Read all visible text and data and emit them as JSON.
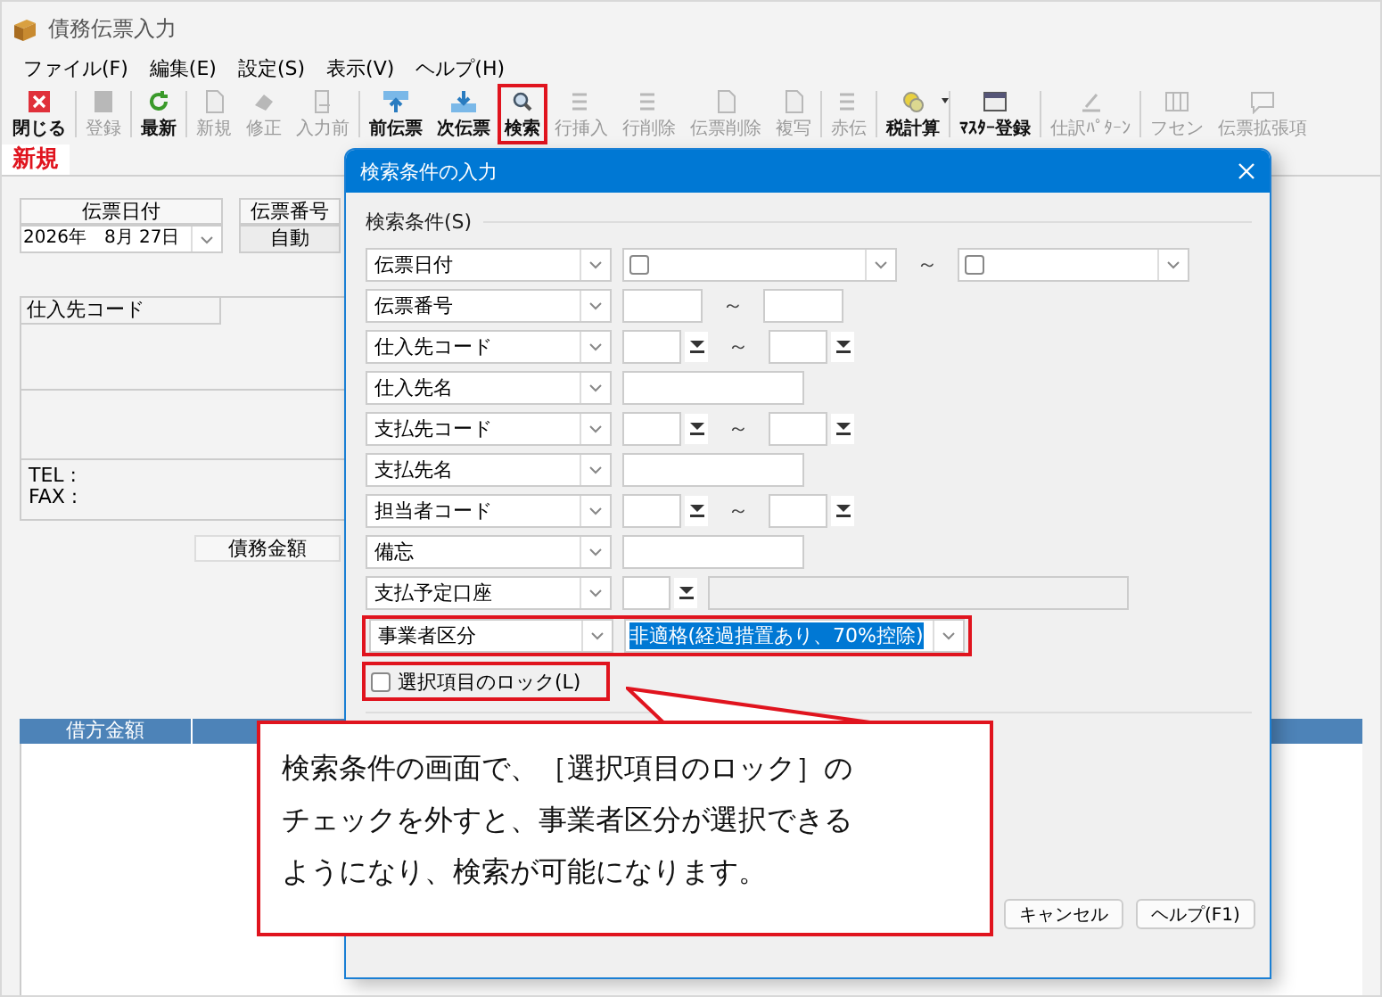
{
  "window": {
    "title": "債務伝票入力"
  },
  "menu": [
    "ファイル(F)",
    "編集(E)",
    "設定(S)",
    "表示(V)",
    "ヘルプ(H)"
  ],
  "toolbar": [
    [
      {
        "label": "閉じる",
        "disabled": false,
        "highlighted": false
      }
    ],
    [
      {
        "label": "登録",
        "disabled": true,
        "highlighted": false
      }
    ],
    [
      {
        "label": "最新",
        "disabled": false,
        "highlighted": false
      }
    ],
    [
      {
        "label": "新規",
        "disabled": true,
        "highlighted": false
      },
      {
        "label": "修正",
        "disabled": true,
        "highlighted": false
      },
      {
        "label": "入力前",
        "disabled": true,
        "highlighted": false
      }
    ],
    [
      {
        "label": "前伝票",
        "disabled": false,
        "highlighted": false
      },
      {
        "label": "次伝票",
        "disabled": false,
        "highlighted": false
      },
      {
        "label": "検索",
        "disabled": false,
        "highlighted": true
      },
      {
        "label": "行挿入",
        "disabled": true,
        "highlighted": false
      },
      {
        "label": "行削除",
        "disabled": true,
        "highlighted": false
      },
      {
        "label": "伝票削除",
        "disabled": true,
        "highlighted": false
      },
      {
        "label": "複写",
        "disabled": true,
        "highlighted": false
      }
    ],
    [
      {
        "label": "赤伝",
        "disabled": true,
        "highlighted": false
      }
    ],
    [
      {
        "label": "税計算",
        "disabled": false,
        "highlighted": false,
        "dropdown": true
      }
    ],
    [
      {
        "label": "ﾏｽﾀｰ登録",
        "disabled": false,
        "highlighted": false
      }
    ],
    [
      {
        "label": "仕訳ﾊﾟﾀｰﾝ",
        "disabled": true,
        "highlighted": false
      }
    ],
    [
      {
        "label": "フセン",
        "disabled": true,
        "highlighted": false
      },
      {
        "label": "伝票拡張項",
        "disabled": true,
        "highlighted": false
      }
    ]
  ],
  "mode_tab": "新規",
  "form": {
    "date_header": "伝票日付",
    "date_value": "2026年　8月 27日",
    "number_header": "伝票番号",
    "number_value": "自動",
    "supplier_label": "仕入先コード",
    "tel_label": "TEL :",
    "fax_label": "FAX :",
    "amount_label": "債務金額",
    "table_header": "借方金額"
  },
  "dialog": {
    "title": "検索条件の入力",
    "section": "検索条件(S)",
    "rows": [
      {
        "field": "伝票日付",
        "kind": "date-range",
        "highlighted": false
      },
      {
        "field": "伝票番号",
        "kind": "text-range",
        "highlighted": false
      },
      {
        "field": "仕入先コード",
        "kind": "code-range",
        "highlighted": false
      },
      {
        "field": "仕入先名",
        "kind": "text",
        "highlighted": false
      },
      {
        "field": "支払先コード",
        "kind": "code-range",
        "highlighted": false
      },
      {
        "field": "支払先名",
        "kind": "text",
        "highlighted": false
      },
      {
        "field": "担当者コード",
        "kind": "code-range",
        "highlighted": false
      },
      {
        "field": "備忘",
        "kind": "text",
        "highlighted": false
      },
      {
        "field": "支払予定口座",
        "kind": "account",
        "highlighted": false
      },
      {
        "field": "事業者区分",
        "kind": "select",
        "value": "非適格(経過措置あり、70%控除)",
        "highlighted": true
      }
    ],
    "range_mark": "～",
    "lock": {
      "label": "選択項目のロック(L)",
      "checked": false,
      "highlighted": true
    },
    "buttons": [
      "キャンセル",
      "ヘルプ(F1)"
    ]
  },
  "callout": {
    "lines": [
      "検索条件の画面で、［選択項目のロック］の",
      "チェックを外すと、事業者区分が選択できる",
      "ようになり、検索が可能になります。"
    ]
  }
}
